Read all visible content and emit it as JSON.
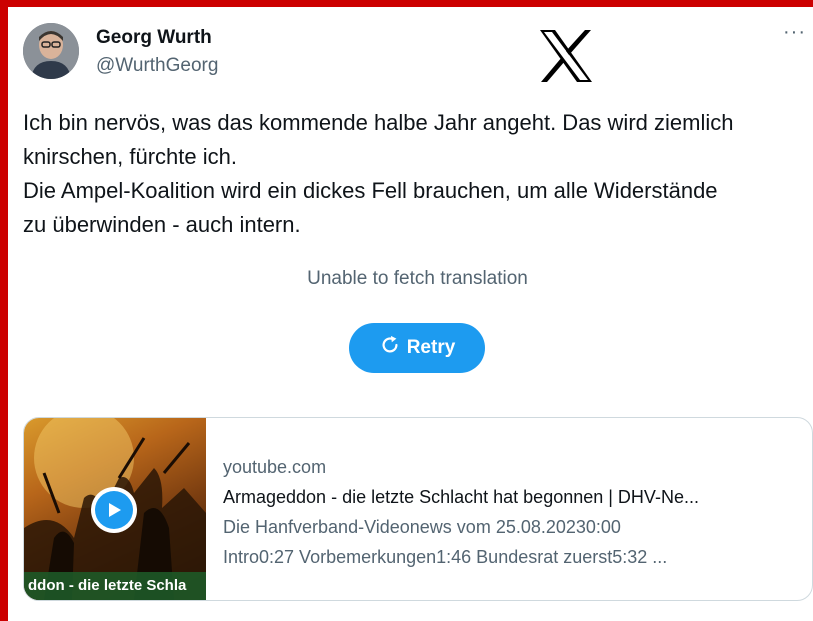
{
  "author": {
    "name": "Georg Wurth",
    "handle": "@WurthGeorg"
  },
  "menu": {
    "more_label": "···"
  },
  "tweet": {
    "lines": [
      "Ich bin nervös, was das kommende halbe Jahr angeht. Das wird ziemlich",
      "knirschen, fürchte ich.",
      "Die Ampel-Koalition wird ein dickes Fell brauchen, um alle Widerstände",
      "zu überwinden - auch intern."
    ]
  },
  "translation": {
    "status": "Unable to fetch translation",
    "retry_label": "Retry"
  },
  "link_card": {
    "thumbnail_caption": "ddon - die letzte Schla",
    "domain": "youtube.com",
    "title": "Armageddon - die letzte Schlacht hat begonnen | DHV-Ne...",
    "description_lines": [
      "Die Hanfverband-Videonews vom 25.08.20230:00",
      "Intro0:27 Vorbemerkungen1:46 Bundesrat zuerst5:32 ..."
    ]
  },
  "colors": {
    "accent": "#1d9bf0",
    "frame": "#cc0000",
    "text_primary": "#0f1419",
    "text_secondary": "#536471"
  },
  "icons": [
    "avatar",
    "x-logo-icon",
    "more-icon",
    "refresh-icon",
    "play-icon"
  ]
}
